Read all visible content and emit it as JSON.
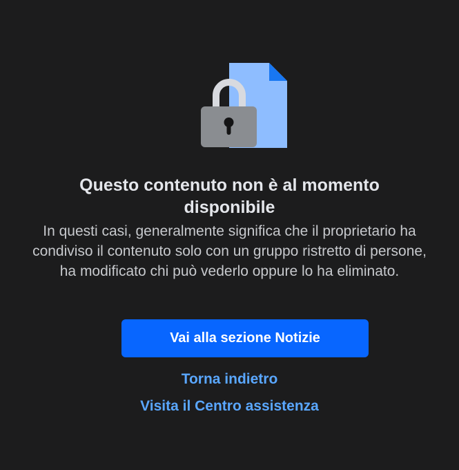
{
  "message": {
    "title": "Questo contenuto non è al momento disponibile",
    "description": "In questi casi, generalmente significa che il proprietario ha condiviso il contenuto solo con un gruppo ristretto di persone, ha modificato chi può vederlo oppure lo ha eliminato."
  },
  "actions": {
    "primary_label": "Vai alla sezione Notizie",
    "back_label": "Torna indietro",
    "help_label": "Visita il Centro assistenza"
  },
  "icons": {
    "illustration": "locked-document-icon"
  },
  "colors": {
    "background": "#1c1c1d",
    "primary_button": "#0866ff",
    "link": "#5aa7ff",
    "document": "#8ebdff",
    "document_fold": "#1877f2",
    "lock_body": "#8a8d91",
    "lock_shackle": "#d8dadf"
  }
}
